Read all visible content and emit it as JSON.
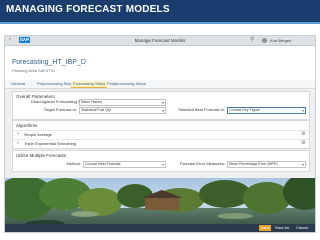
{
  "slide": {
    "title": "MANAGING FORECAST MODELS"
  },
  "shell": {
    "title": "Manage Forecast Models",
    "user": "Kurt Bergen",
    "logo": "SAP",
    "back_icon": "back-icon",
    "search_icon": "search-icon"
  },
  "header": {
    "title": "Forecasting_HT_IBP_D",
    "subtitle": "Planning Area SAP4T01"
  },
  "tabs": [
    "General",
    "Preprocessing Steps",
    "Forecasting Steps",
    "Postprocessing Steps"
  ],
  "active_tab": 2,
  "overall": {
    "title": "Overall Parameters",
    "field1_label": "Dead Against Forecasting Steps:",
    "field1_value": "Sales History",
    "field2_label": "Target Forecast to:",
    "field2_value": "Statistical Fcst Qty",
    "field3_label": "Selected Best Forecast in:",
    "field3_value": "Choose Key Figure"
  },
  "algorithms": {
    "title": "Algorithms",
    "items": [
      "Simple Average",
      "Triple Exponential Smoothing"
    ]
  },
  "multiple": {
    "title": "Utilize Multiple Forecasts",
    "field1_label": "Method:",
    "field1_value": "Choose Best Forecast",
    "field2_label": "Forecast Error Measures:",
    "field2_value": "Mean Percentage Error (MPE)"
  },
  "footer": {
    "save": "Save",
    "save_as": "Save As",
    "cancel": "Cancel"
  },
  "colors": {
    "slide_bar": "#1b3d6e",
    "shell": "#dde1e5",
    "accent": "#346187",
    "primary_button": "#e7a12e"
  }
}
